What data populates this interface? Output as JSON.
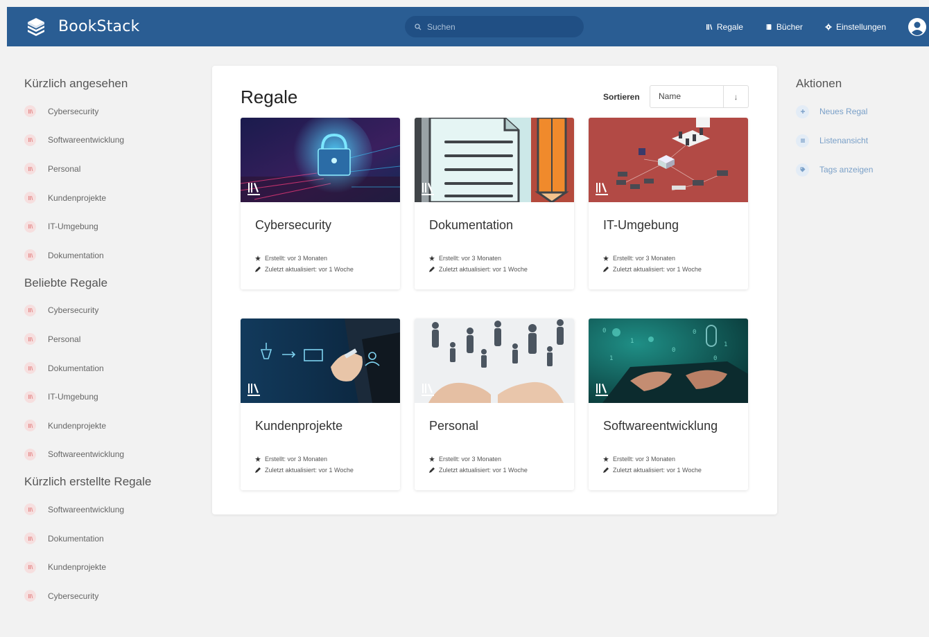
{
  "colors": {
    "header": "#2a5d93",
    "accent_link": "#7aa0c8",
    "shelf_icon_bg": "#f6dfdf",
    "shelf_icon": "#e06666"
  },
  "header": {
    "app_name": "BookStack",
    "search_placeholder": "Suchen",
    "nav": [
      {
        "label": "Regale",
        "icon": "shelves-icon"
      },
      {
        "label": "Bücher",
        "icon": "book-icon"
      },
      {
        "label": "Einstellungen",
        "icon": "gear-icon"
      }
    ]
  },
  "left_sidebar": {
    "recently_viewed": {
      "title": "Kürzlich angesehen",
      "items": [
        "Cybersecurity",
        "Softwareentwicklung",
        "Personal",
        "Kundenprojekte",
        "IT-Umgebung",
        "Dokumentation"
      ]
    },
    "popular_shelves": {
      "title": "Beliebte Regale",
      "items": [
        "Cybersecurity",
        "Personal",
        "Dokumentation",
        "IT-Umgebung",
        "Kundenprojekte",
        "Softwareentwicklung"
      ]
    },
    "recently_created": {
      "title": "Kürzlich erstellte Regale",
      "items": [
        "Softwareentwicklung",
        "Dokumentation",
        "Kundenprojekte",
        "Cybersecurity"
      ]
    }
  },
  "main": {
    "title": "Regale",
    "sort_label": "Sortieren",
    "sort_value": "Name",
    "sort_direction": "↓",
    "shelves": [
      {
        "name": "Cybersecurity",
        "created": "Erstellt: vor 3 Monaten",
        "updated": "Zuletzt aktualisiert: vor 1 Woche",
        "cover": "cybersecurity-cover"
      },
      {
        "name": "Dokumentation",
        "created": "Erstellt: vor 3 Monaten",
        "updated": "Zuletzt aktualisiert: vor 1 Woche",
        "cover": "document-cover"
      },
      {
        "name": "IT-Umgebung",
        "created": "Erstellt: vor 3 Monaten",
        "updated": "Zuletzt aktualisiert: vor 1 Woche",
        "cover": "network-cover"
      },
      {
        "name": "Kundenprojekte",
        "created": "Erstellt: vor 3 Monaten",
        "updated": "Zuletzt aktualisiert: vor 1 Woche",
        "cover": "business-cover"
      },
      {
        "name": "Personal",
        "created": "Erstellt: vor 3 Monaten",
        "updated": "Zuletzt aktualisiert: vor 1 Woche",
        "cover": "people-cover"
      },
      {
        "name": "Softwareentwicklung",
        "created": "Erstellt: vor 3 Monaten",
        "updated": "Zuletzt aktualisiert: vor 1 Woche",
        "cover": "coding-cover"
      }
    ]
  },
  "right_sidebar": {
    "title": "Aktionen",
    "actions": [
      {
        "label": "Neues Regal",
        "icon": "plus-icon"
      },
      {
        "label": "Listenansicht",
        "icon": "list-icon"
      },
      {
        "label": "Tags anzeigen",
        "icon": "tag-icon"
      }
    ]
  }
}
